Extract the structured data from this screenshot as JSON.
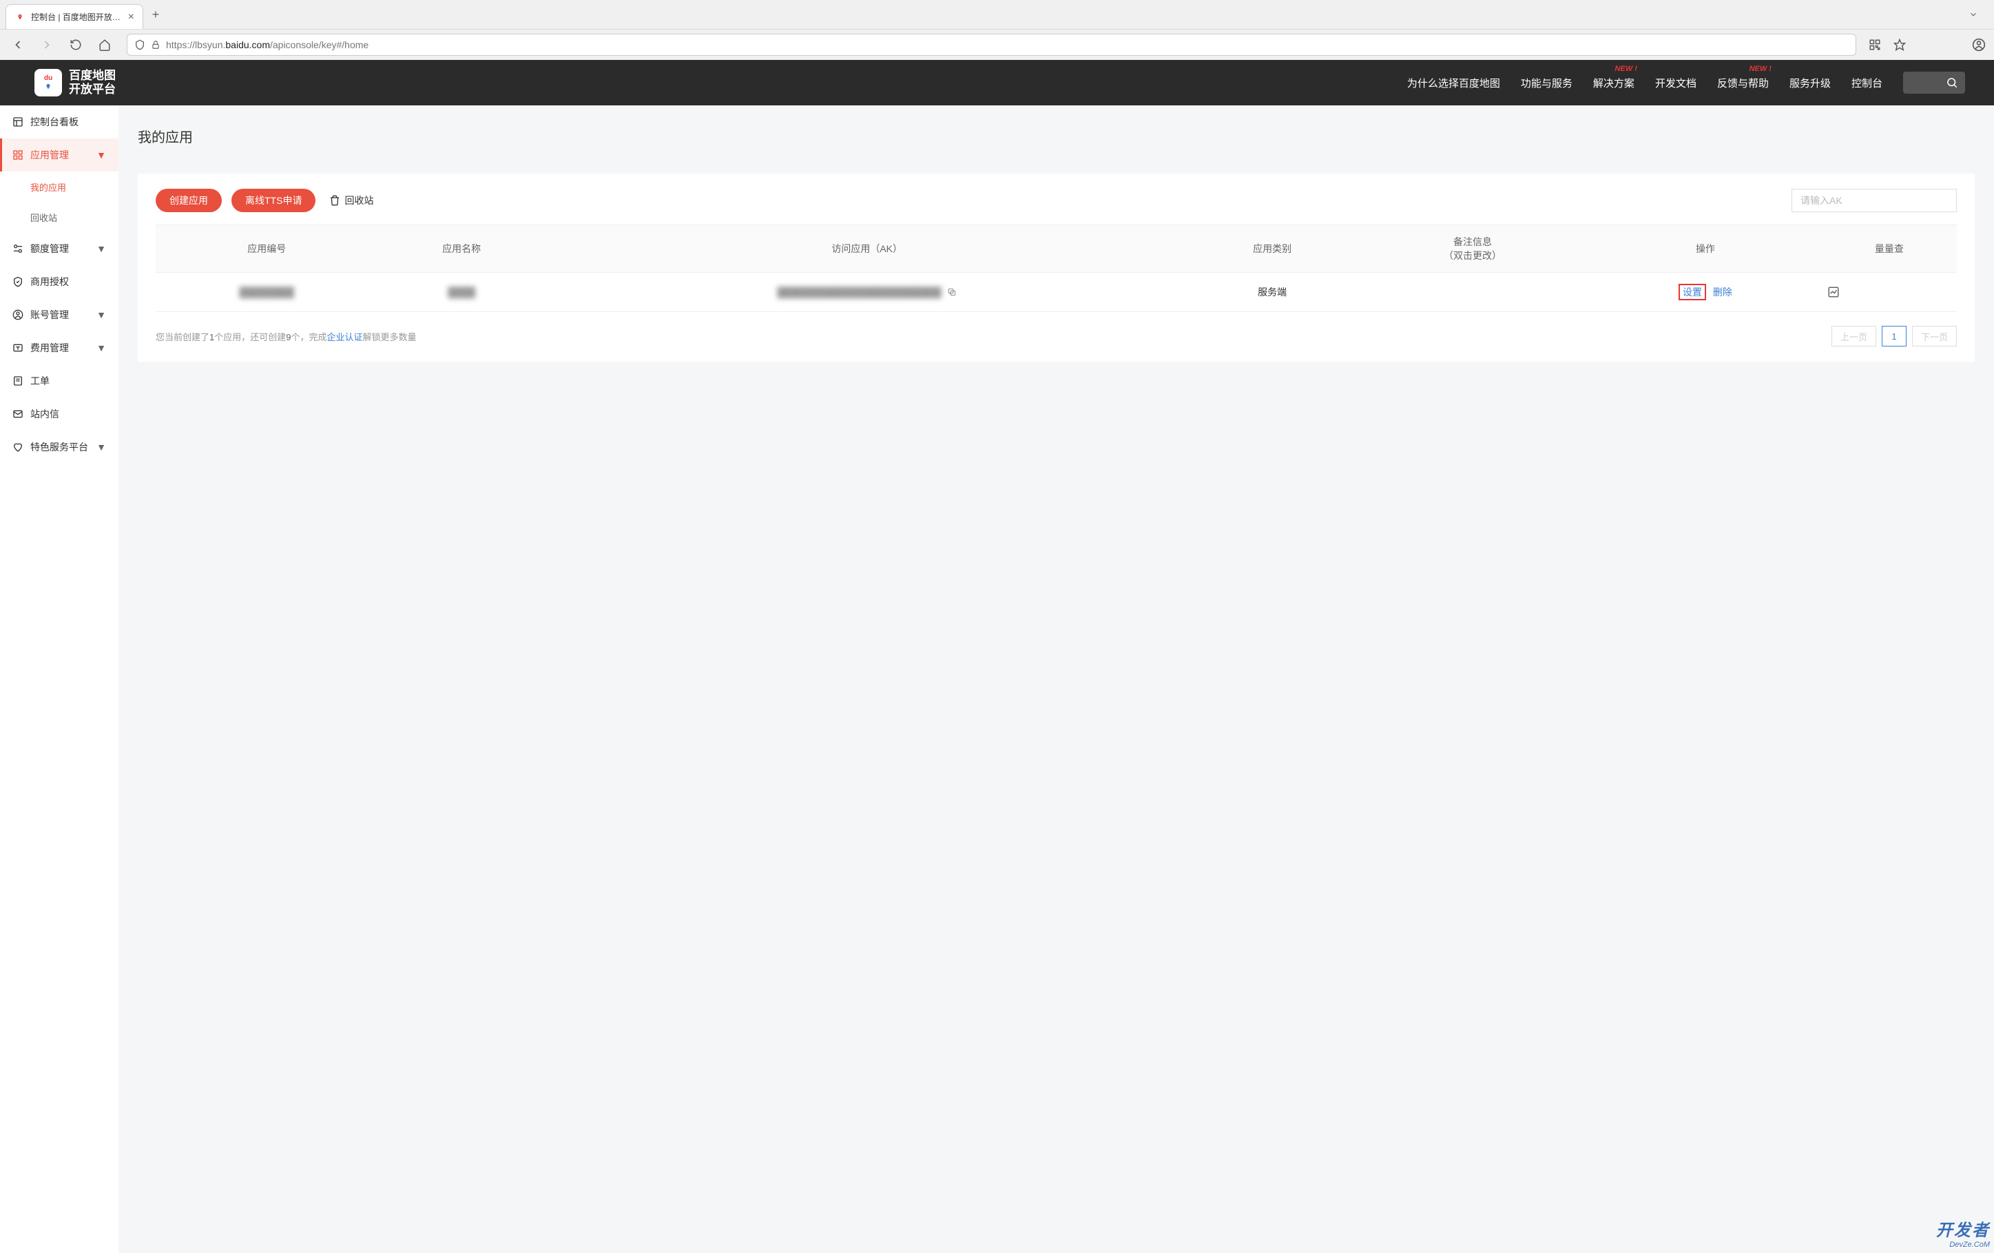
{
  "browser": {
    "tab_title": "控制台 | 百度地图开放平台",
    "url_prefix": "https://lbsyun.",
    "url_domain": "baidu.com",
    "url_path": "/apiconsole/key#/home"
  },
  "header": {
    "logo_line1": "百度地图",
    "logo_line2": "开放平台",
    "logo_badge": "du",
    "nav": [
      {
        "label": "为什么选择百度地图",
        "new": false
      },
      {
        "label": "功能与服务",
        "new": false
      },
      {
        "label": "解决方案",
        "new": true
      },
      {
        "label": "开发文档",
        "new": false
      },
      {
        "label": "反馈与帮助",
        "new": true
      },
      {
        "label": "服务升级",
        "new": false
      },
      {
        "label": "控制台",
        "new": false
      }
    ],
    "new_badge": "NEW !"
  },
  "sidebar": {
    "items": [
      {
        "icon": "dashboard",
        "label": "控制台看板",
        "arrow": false
      },
      {
        "icon": "apps",
        "label": "应用管理",
        "arrow": true,
        "active": true,
        "subs": [
          {
            "label": "我的应用",
            "selected": true
          },
          {
            "label": "回收站",
            "selected": false
          }
        ]
      },
      {
        "icon": "quota",
        "label": "额度管理",
        "arrow": true
      },
      {
        "icon": "shield",
        "label": "商用授权",
        "arrow": false
      },
      {
        "icon": "user",
        "label": "账号管理",
        "arrow": true
      },
      {
        "icon": "fee",
        "label": "费用管理",
        "arrow": true
      },
      {
        "icon": "ticket",
        "label": "工单",
        "arrow": false
      },
      {
        "icon": "mail",
        "label": "站内信",
        "arrow": false
      },
      {
        "icon": "heart",
        "label": "特色服务平台",
        "arrow": true
      }
    ]
  },
  "main": {
    "title": "我的应用",
    "create_btn": "创建应用",
    "tts_btn": "离线TTS申请",
    "recycle_btn": "回收站",
    "search_placeholder": "请输入AK",
    "columns": {
      "app_id": "应用编号",
      "app_name": "应用名称",
      "ak": "访问应用（AK）",
      "app_type": "应用类别",
      "remark": "备注信息\n（双击更改）",
      "action": "操作",
      "usage": "量量查"
    },
    "row": {
      "app_id": "████████",
      "app_name": "████",
      "ak": "████████████████████████",
      "app_type": "服务端",
      "action_set": "设置",
      "action_del": "删除"
    },
    "footer": {
      "pre": "您当前创建了",
      "created": "1",
      "mid1": "个应用，还可创建",
      "remain": "9",
      "mid2": "个，完成",
      "cert": "企业认证",
      "post": "解锁更多数量"
    },
    "pagination": {
      "prev": "上一页",
      "page": "1",
      "next": "下一页"
    }
  },
  "watermark": {
    "l1": "开发者",
    "l2": "DevZe.CoM"
  }
}
